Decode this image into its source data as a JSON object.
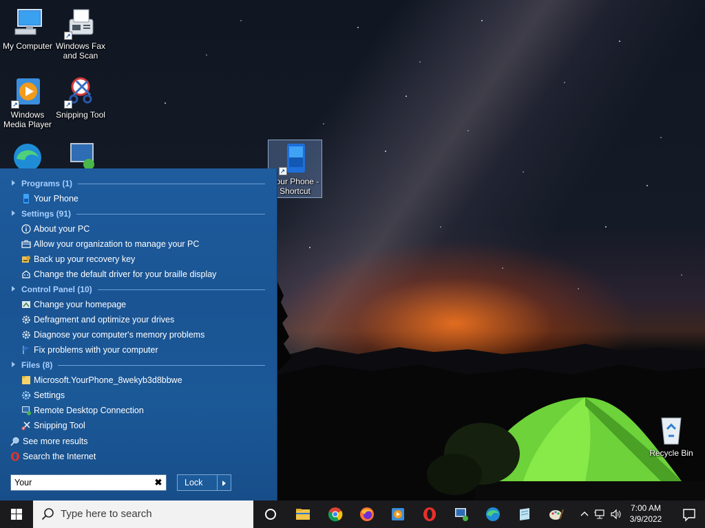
{
  "desktop": {
    "icons": [
      {
        "label": "My Computer",
        "icon": "computer-icon"
      },
      {
        "label": "Windows Fax and Scan",
        "icon": "fax-icon"
      },
      {
        "label": "Windows Media Player",
        "icon": "media-player-icon"
      },
      {
        "label": "Snipping Tool",
        "icon": "snipping-tool-icon"
      },
      {
        "label": "Your Phone - Shortcut",
        "icon": "phone-icon"
      },
      {
        "label": "Recycle Bin",
        "icon": "recycle-bin-icon"
      }
    ]
  },
  "start_menu": {
    "sections": [
      {
        "header": "Programs (1)",
        "items": [
          {
            "label": "Your Phone",
            "icon": "phone-icon"
          }
        ]
      },
      {
        "header": "Settings (91)",
        "items": [
          {
            "label": "About your PC",
            "icon": "info-icon"
          },
          {
            "label": "Allow your organization to manage your PC",
            "icon": "briefcase-icon"
          },
          {
            "label": "Back up your recovery key",
            "icon": "key-icon"
          },
          {
            "label": "Change the default driver for your braille display",
            "icon": "braille-icon"
          }
        ]
      },
      {
        "header": "Control Panel (10)",
        "items": [
          {
            "label": "Change your homepage",
            "icon": "internet-options-icon"
          },
          {
            "label": "Defragment and optimize your drives",
            "icon": "admin-tools-icon"
          },
          {
            "label": "Diagnose your computer's memory problems",
            "icon": "admin-tools-icon"
          },
          {
            "label": "Fix problems with your computer",
            "icon": "flag-icon"
          }
        ]
      },
      {
        "header": "Files (8)",
        "items": [
          {
            "label": "Microsoft.YourPhone_8wekyb3d8bbwe",
            "icon": "folder-icon"
          },
          {
            "label": "Settings",
            "icon": "gear-icon"
          },
          {
            "label": "Remote Desktop Connection",
            "icon": "remote-desktop-icon"
          },
          {
            "label": "Snipping Tool",
            "icon": "snipping-tool-icon"
          }
        ]
      }
    ],
    "footer": [
      {
        "label": "See more results",
        "icon": "search-icon"
      },
      {
        "label": "Search the Internet",
        "icon": "opera-icon"
      }
    ],
    "search_value": "Your",
    "lock_label": "Lock"
  },
  "taskbar": {
    "search_placeholder": "Type here to search",
    "pinned": [
      "cortana-icon",
      "file-explorer-icon",
      "chrome-icon",
      "firefox-icon",
      "media-player-icon",
      "opera-icon",
      "remote-desktop-icon",
      "edge-icon",
      "notepad-icon",
      "paint-icon"
    ],
    "time": "7:00 AM",
    "date": "3/9/2022"
  },
  "colors": {
    "start_menu_bg": "#1a5493",
    "category_header": "#a8d0ff",
    "taskbar_bg": "#1b1b1d"
  }
}
